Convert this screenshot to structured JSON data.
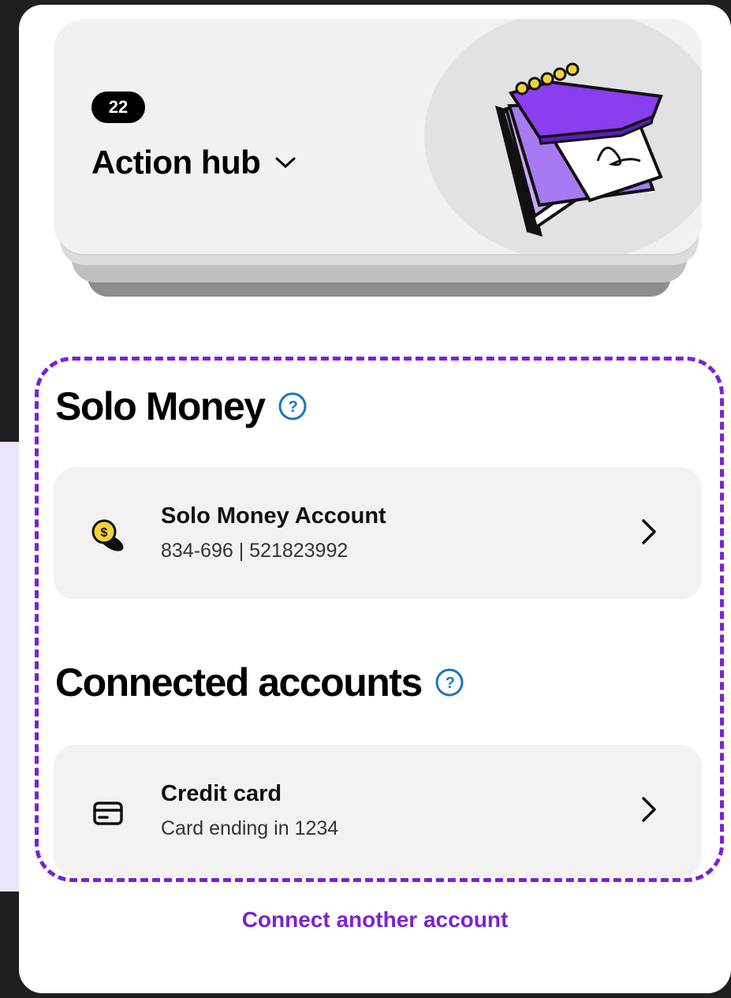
{
  "hub": {
    "badge_count": "22",
    "title": "Action hub",
    "chevron": "chevron-down-icon",
    "illustration": "notebook-illustration"
  },
  "solo_money": {
    "heading": "Solo Money",
    "help_icon": "help-icon",
    "account": {
      "icon": "coin-icon",
      "title": "Solo Money Account",
      "subtitle": "834-696 | 521823992"
    }
  },
  "connected": {
    "heading": "Connected accounts",
    "help_icon": "help-icon",
    "accounts": [
      {
        "icon": "credit-card-icon",
        "title": "Credit card",
        "subtitle": "Card ending in 1234"
      }
    ]
  },
  "connect_link": "Connect another account",
  "colors": {
    "accent": "#7a22d6",
    "help_blue": "#1a73c4",
    "card_bg": "#f2f2f3",
    "notebook_purple": "#8b3df0"
  }
}
